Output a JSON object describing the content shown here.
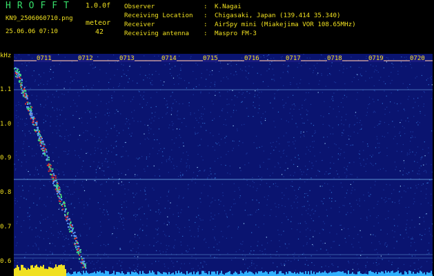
{
  "header": {
    "logo": "HROFFT",
    "version": "1.0.0f",
    "filename": "KN9_2506060710.png",
    "meteor_label": "meteor",
    "datetime": "25.06.06 07:10",
    "meteor_count": "42"
  },
  "info": [
    {
      "key": "Observer",
      "value": "K.Nagai"
    },
    {
      "key": "Receiving Location",
      "value": "Chigasaki, Japan (139.414 35.340)"
    },
    {
      "key": "Receiver",
      "value": "AirSpy mini (Miakejima VOR 108.65MHz)"
    },
    {
      "key": "Receiving antenna",
      "value": "Maspro FM-3"
    }
  ],
  "yaxis": {
    "unit": "kHz",
    "labels": [
      "1.1",
      "1.0",
      "0.9",
      "0.8",
      "0.7",
      "0.6"
    ]
  },
  "time_ticks": [
    "0711",
    "0712",
    "0713",
    "0714",
    "0715",
    "0716",
    "0717",
    "0718",
    "0719",
    "0720"
  ],
  "colors": {
    "background": "#0a1470",
    "text": "#f0e020",
    "logo": "#37e06a",
    "trail": "#e03030",
    "baseline": "#30b0ff"
  }
}
